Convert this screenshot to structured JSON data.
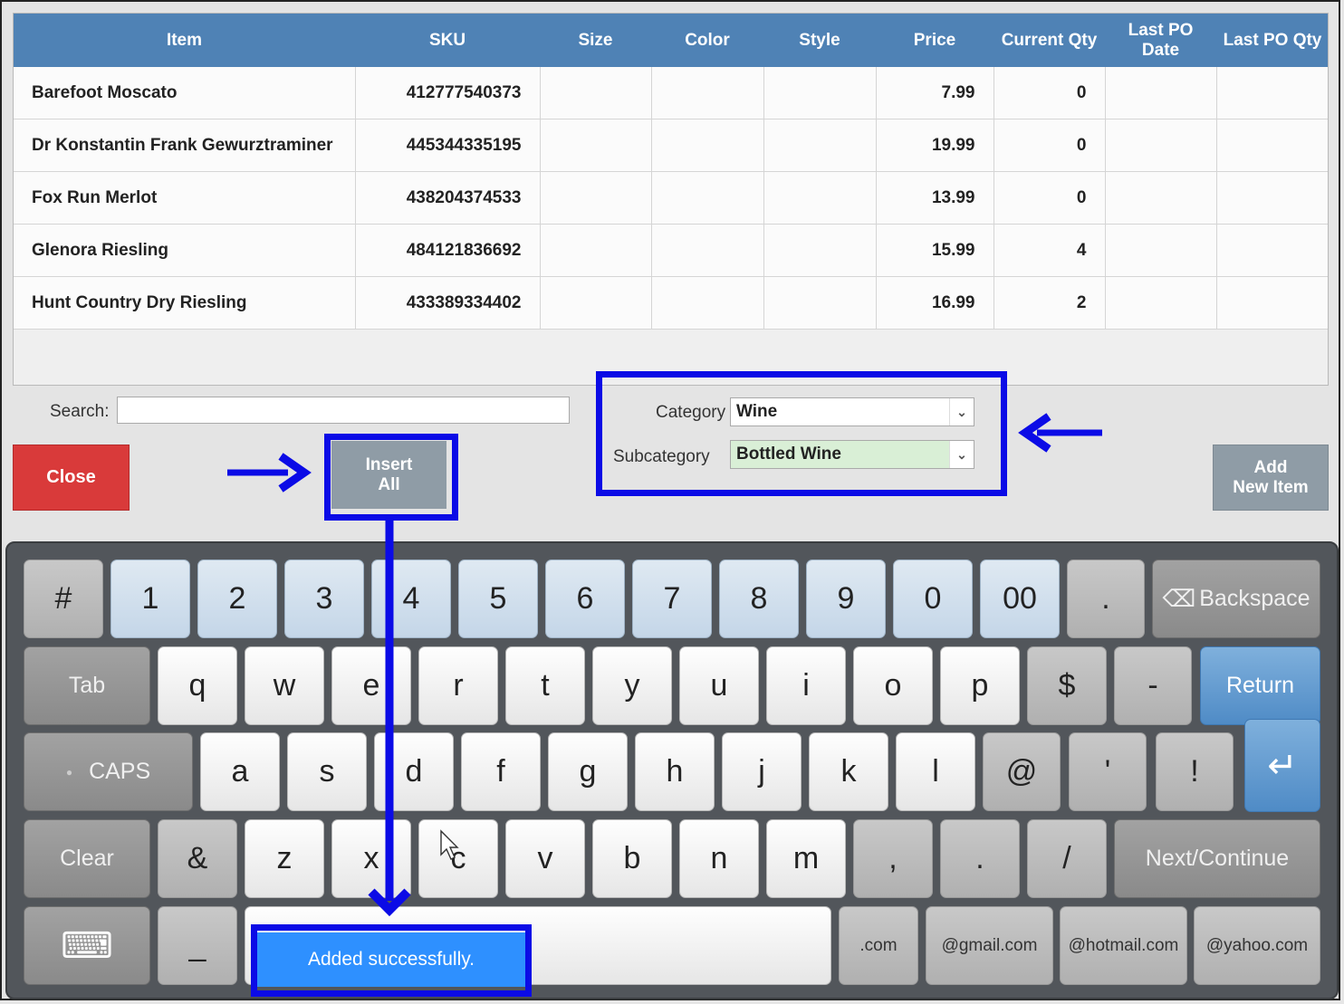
{
  "table": {
    "headers": [
      "Item",
      "SKU",
      "Size",
      "Color",
      "Style",
      "Price",
      "Current Qty",
      "Last PO Date",
      "Last PO Qty"
    ],
    "rows": [
      {
        "item": "Barefoot Moscato",
        "sku": "412777540373",
        "price": "7.99",
        "qty": "0"
      },
      {
        "item": "Dr Konstantin Frank Gewurztraminer",
        "sku": "445344335195",
        "price": "19.99",
        "qty": "0"
      },
      {
        "item": "Fox Run Merlot",
        "sku": "438204374533",
        "price": "13.99",
        "qty": "0"
      },
      {
        "item": "Glenora Riesling",
        "sku": "484121836692",
        "price": "15.99",
        "qty": "4"
      },
      {
        "item": "Hunt Country Dry Riesling",
        "sku": "433389334402",
        "price": "16.99",
        "qty": "2"
      }
    ]
  },
  "search": {
    "label": "Search:",
    "value": ""
  },
  "buttons": {
    "close": "Close",
    "insert_line1": "Insert",
    "insert_line2": "All",
    "add_line1": "Add",
    "add_line2": "New Item"
  },
  "filters": {
    "category_label": "Category",
    "category_value": "Wine",
    "subcategory_label": "Subcategory",
    "subcategory_value": "Bottled Wine"
  },
  "keyboard": {
    "row1": [
      "#",
      "1",
      "2",
      "3",
      "4",
      "5",
      "6",
      "7",
      "8",
      "9",
      "0",
      "00",
      ".",
      "Backspace"
    ],
    "row2": [
      "Tab",
      "q",
      "w",
      "e",
      "r",
      "t",
      "y",
      "u",
      "i",
      "o",
      "p",
      "$",
      "-",
      "Return"
    ],
    "row3": [
      "CAPS",
      "a",
      "s",
      "d",
      "f",
      "g",
      "h",
      "j",
      "k",
      "l",
      "@",
      "'",
      "!"
    ],
    "row4": [
      "Clear",
      "&",
      "z",
      "x",
      "c",
      "v",
      "b",
      "n",
      "m",
      ",",
      ".",
      "/",
      "Next/Continue"
    ],
    "row5": [
      "_",
      ".com",
      "@gmail.com",
      "@hotmail.com",
      "@yahoo.com"
    ]
  },
  "toast": "Added successfully.",
  "colors": {
    "header": "#4f82b5",
    "close": "#d93a3a",
    "annotation": "#0b0be6",
    "toast": "#2e90ff",
    "subcategory_bg": "#d9efd6"
  }
}
